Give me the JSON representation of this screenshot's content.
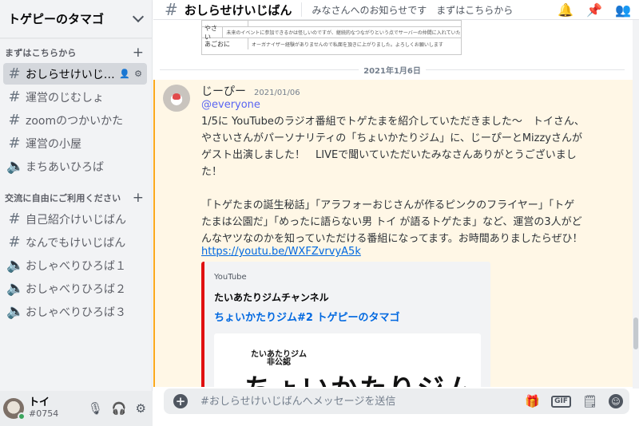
{
  "server": {
    "name": "トゲピーのタマゴ"
  },
  "categories": [
    {
      "label": "まずはこちらから",
      "channels": [
        {
          "label": "おしらせけいじば...",
          "icon": "text-channel-icon",
          "active": true
        },
        {
          "label": "運営のじむしょ",
          "icon": "text-channel-icon"
        },
        {
          "label": "zoomのつかいかた",
          "icon": "text-channel-icon"
        },
        {
          "label": "運営の小屋",
          "icon": "text-channel-icon"
        },
        {
          "label": "まちあいひろば",
          "icon": "voice-channel-icon"
        }
      ]
    },
    {
      "label": "交流に自由にご利用ください",
      "channels": [
        {
          "label": "自己紹介けいじばん",
          "icon": "text-channel-icon"
        },
        {
          "label": "なんでもけいじばん",
          "icon": "text-channel-icon"
        },
        {
          "label": "おしゃべりひろば１",
          "icon": "voice-channel-icon"
        },
        {
          "label": "おしゃべりひろば２",
          "icon": "voice-channel-icon"
        },
        {
          "label": "おしゃべりひろば３",
          "icon": "voice-channel-icon"
        }
      ]
    }
  ],
  "user": {
    "name": "トイ",
    "tag": "#0754"
  },
  "topbar": {
    "channel": "おしらせけいじばん",
    "topic": "みなさんへのお知らせです　まずはこちらから"
  },
  "prev_embed": {
    "rows": [
      {
        "k": "やさい",
        "v": "未来のイベントに参加できるかは怪しいのですが、継続的なつながりという点でサーバーの仲間に入れていただきたく存じます。大したイベントを開催したことはないのですが、小規模なものをいくつか開催させていただいております。よろしくお願いいたします。"
      },
      {
        "k": "あごおに",
        "v": "オーガナイザー経験がありませんので私面を頂きに上がりました。よろしくお願いします"
      }
    ]
  },
  "date_divider": "2021年1月6日",
  "message": {
    "author": "じーぴー",
    "timestamp": "2021/01/06",
    "mention": "@everyone",
    "lines": [
      "1/5に YouTubeのラジオ番組でトゲたまを紹介していただきました～　トイさん、",
      "やさいさんがパーソナリティの「ちょいかたりジム」に、じーぴーとMizzyさんが",
      "ゲスト出演しました！　LIVEで聞いていただいたみなさんありがとうございまし",
      "た！",
      "",
      "「トゲたまの誕生秘話」「アラフォーおじさんが作るピンクのフライヤー」「トゲ",
      "たまは公園だ」「めったに語らない男 トイ が語るトゲたま」など、運営の3人がど",
      "んなヤツなのかを知っていただける番組になってます。お時間ありましたらぜひ！"
    ],
    "link": "https://youtu.be/WXFZvrvyA5k",
    "embed": {
      "provider": "YouTube",
      "author": "たいあたりジムチャンネル",
      "title": "ちょいかたりジム#2 トゲピーのタマゴ",
      "thumb_small": "たいあたりジム\n非公認",
      "thumb_big": "ちょいかたりジム"
    }
  },
  "composer": {
    "placeholder": "#おしらせけいじばんへメッセージを送信",
    "gif": "GIF"
  },
  "colors": {
    "accent": "#5865f2",
    "mention_highlight": "#fff7e6",
    "mention_bar": "#faa81a",
    "link": "#0068e0",
    "embed_bar": "#e01010"
  }
}
